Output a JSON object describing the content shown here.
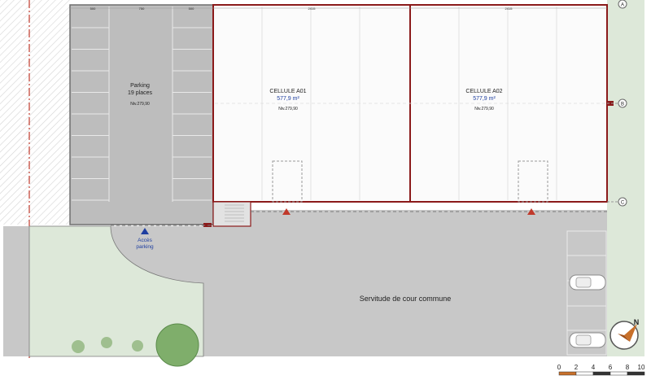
{
  "parking": {
    "title": "Parking",
    "places": "19 places",
    "level": "Niv.279,90"
  },
  "cells": [
    {
      "name": "CELLULE A01",
      "area": "577,9 m²",
      "level": "Niv.279,90"
    },
    {
      "name": "CELLULE A02",
      "area": "577,9 m²",
      "level": "Niv.279,90"
    }
  ],
  "access": {
    "line1": "Accès",
    "line2": "parking"
  },
  "courtyard": "Servitude de cour commune",
  "grid_markers": [
    "A",
    "B",
    "C"
  ],
  "dims_top": [
    "500",
    "750",
    "500",
    "2415",
    "2415"
  ],
  "scale": {
    "ticks": [
      "0",
      "2",
      "4",
      "6",
      "8",
      "10"
    ]
  },
  "compass_letter": "N",
  "colors": {
    "wall": "#8b1a1a",
    "courtyard": "#c8c8c8",
    "parking": "#bdbdbd",
    "green": "#dde8d9",
    "hatch": "#e4e4e4"
  }
}
